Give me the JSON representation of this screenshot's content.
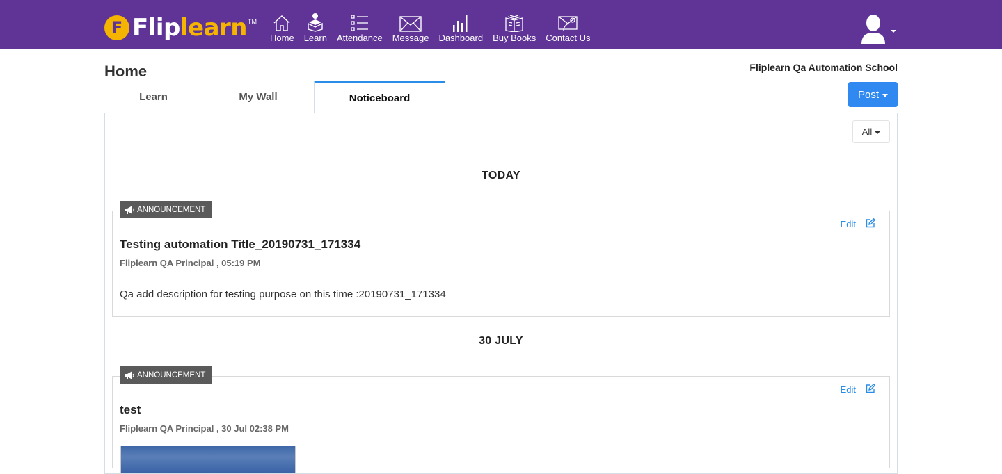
{
  "brand": {
    "logo_letter": "F",
    "logo_text_main": "Flip",
    "logo_text_accent": "learn",
    "logo_tm": "TM",
    "colors": {
      "header_bg": "#5f3496",
      "logo_accent": "#f5b400",
      "primary": "#2f89f0",
      "active_tab_border": "#2a8de9"
    }
  },
  "nav": {
    "items": [
      {
        "label": "Home",
        "icon": "home-icon"
      },
      {
        "label": "Learn",
        "icon": "learn-icon"
      },
      {
        "label": "Attendance",
        "icon": "attendance-list-icon"
      },
      {
        "label": "Message",
        "icon": "envelope-icon"
      },
      {
        "label": "Dashboard",
        "icon": "bar-chart-icon"
      },
      {
        "label": "Buy Books",
        "icon": "book-icon"
      },
      {
        "label": "Contact Us",
        "icon": "contact-envelope-icon"
      }
    ],
    "user_icon": "user-avatar-icon"
  },
  "page": {
    "title": "Home",
    "school_name": "Fliplearn Qa Automation School"
  },
  "tabs": [
    {
      "label": "Learn",
      "active": false
    },
    {
      "label": "My Wall",
      "active": false
    },
    {
      "label": "Noticeboard",
      "active": true
    }
  ],
  "post_button": {
    "label": "Post"
  },
  "filter": {
    "selected": "All"
  },
  "noticeboard": {
    "groups": [
      {
        "date_label": "TODAY",
        "notices": [
          {
            "type": "ANNOUNCEMENT",
            "edit_label": "Edit",
            "title": "Testing automation Title_20190731_171334",
            "meta": "Fliplearn QA Principal , 05:19 PM",
            "description": "Qa add description for testing purpose on this time :20190731_171334"
          }
        ]
      },
      {
        "date_label": "30 JULY",
        "notices": [
          {
            "type": "ANNOUNCEMENT",
            "edit_label": "Edit",
            "title": "test",
            "meta": "Fliplearn QA Principal , 30 Jul 02:38 PM",
            "has_image": true
          }
        ]
      }
    ]
  }
}
